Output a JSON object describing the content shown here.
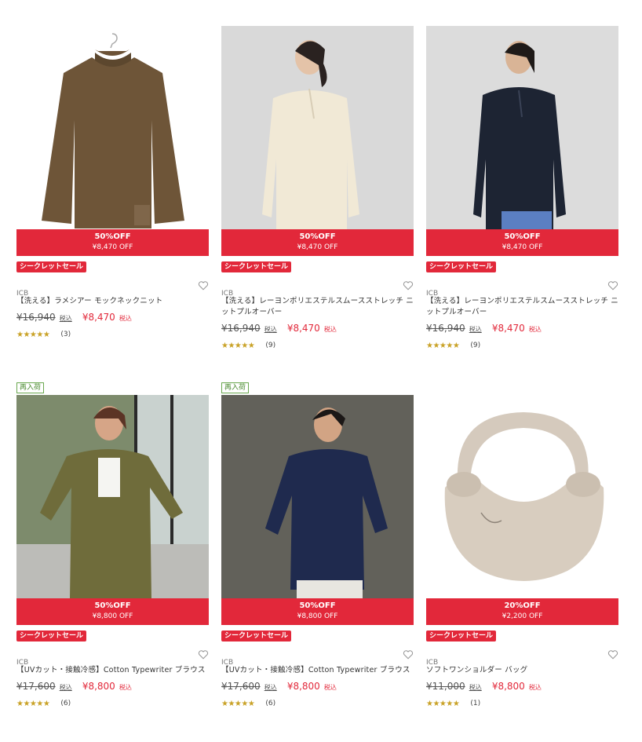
{
  "products": [
    {
      "restock": "",
      "sale_pct": "50%OFF",
      "sale_amount": "¥8,470 OFF",
      "secret_label": "シークレットセール",
      "brand": "ICB",
      "name": "【洗える】ラメシアー モックネックニット",
      "original_price": "¥16,940",
      "original_tax": "税込",
      "sale_price": "¥8,470",
      "sale_tax": "税込",
      "stars": "★★★★★",
      "review_count": "(3)",
      "rating": 4.5,
      "favorite_icon": "heart-outline-icon"
    },
    {
      "restock": "",
      "sale_pct": "50%OFF",
      "sale_amount": "¥8,470 OFF",
      "secret_label": "シークレットセール",
      "brand": "ICB",
      "name": "【洗える】レーヨンポリエステルスムースストレッチ ニットプルオーバー",
      "original_price": "¥16,940",
      "original_tax": "税込",
      "sale_price": "¥8,470",
      "sale_tax": "税込",
      "stars": "★★★★★",
      "review_count": "(9)",
      "rating": 4.5,
      "favorite_icon": "heart-outline-icon"
    },
    {
      "restock": "",
      "sale_pct": "50%OFF",
      "sale_amount": "¥8,470 OFF",
      "secret_label": "シークレットセール",
      "brand": "ICB",
      "name": "【洗える】レーヨンポリエステルスムースストレッチ ニットプルオーバー",
      "original_price": "¥16,940",
      "original_tax": "税込",
      "sale_price": "¥8,470",
      "sale_tax": "税込",
      "stars": "★★★★★",
      "review_count": "(9)",
      "rating": 4.5,
      "favorite_icon": "heart-outline-icon"
    },
    {
      "restock": "再入荷",
      "sale_pct": "50%OFF",
      "sale_amount": "¥8,800 OFF",
      "secret_label": "シークレットセール",
      "brand": "ICB",
      "name": "【UVカット・接触冷感】Cotton Typewriter ブラウス",
      "original_price": "¥17,600",
      "original_tax": "税込",
      "sale_price": "¥8,800",
      "sale_tax": "税込",
      "stars": "★★★★★",
      "review_count": "(6)",
      "rating": 4.5,
      "favorite_icon": "heart-outline-icon"
    },
    {
      "restock": "再入荷",
      "sale_pct": "50%OFF",
      "sale_amount": "¥8,800 OFF",
      "secret_label": "シークレットセール",
      "brand": "ICB",
      "name": "【UVカット・接触冷感】Cotton Typewriter ブラウス",
      "original_price": "¥17,600",
      "original_tax": "税込",
      "sale_price": "¥8,800",
      "sale_tax": "税込",
      "stars": "★★★★★",
      "review_count": "(6)",
      "rating": 4.5,
      "favorite_icon": "heart-outline-icon"
    },
    {
      "restock": "",
      "sale_pct": "20%OFF",
      "sale_amount": "¥2,200 OFF",
      "secret_label": "シークレットセール",
      "brand": "ICB",
      "name": "ソフトワンショルダー バッグ",
      "original_price": "¥11,000",
      "original_tax": "税込",
      "sale_price": "¥8,800",
      "sale_tax": "税込",
      "stars": "★★★★★",
      "review_count": "(1)",
      "rating": 5,
      "favorite_icon": "heart-outline-icon"
    }
  ],
  "colors": {
    "sale_red": "#e2283a",
    "star_gold": "#c9a227",
    "restock_green": "#6aa84f"
  }
}
